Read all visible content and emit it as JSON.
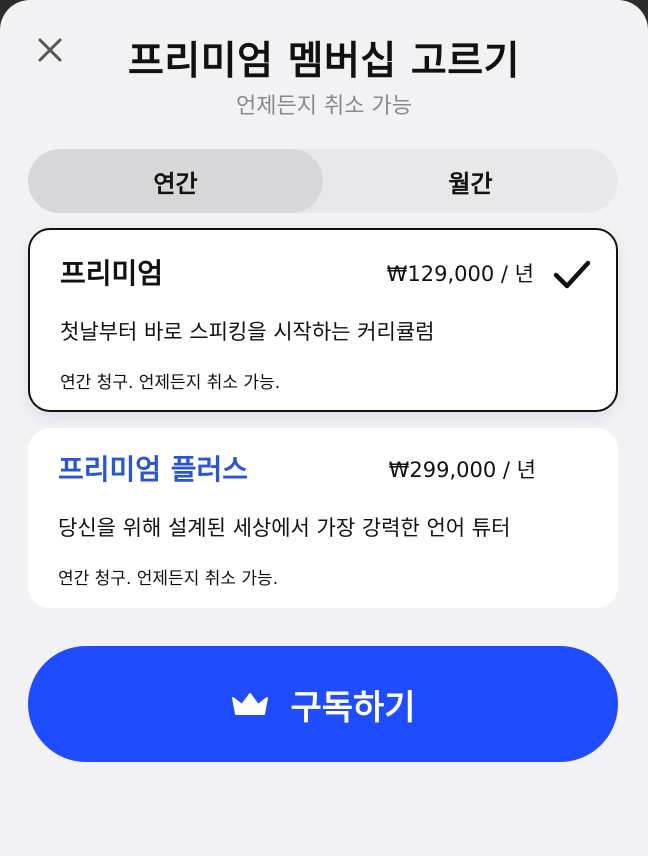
{
  "header": {
    "title": "프리미엄 멤버십 고르기",
    "subtitle": "언제든지 취소 가능"
  },
  "billing_toggle": {
    "options": [
      "연간",
      "월간"
    ],
    "selected": "연간"
  },
  "plans": [
    {
      "name": "프리미엄",
      "price": "₩129,000 / 년",
      "description": "첫날부터 바로 스피킹을 시작하는 커리큘럼",
      "billing": "연간 청구. 언제든지 취소 가능.",
      "selected": true,
      "name_color": "#111111"
    },
    {
      "name": "프리미엄 플러스",
      "price": "₩299,000 / 년",
      "description": "당신을 위해 설계된 세상에서 가장 강력한 언어 튜터",
      "billing": "연간 청구. 언제든지 취소 가능.",
      "selected": false,
      "name_color": "#2a56d6"
    }
  ],
  "cta": {
    "label": "구독하기",
    "icon": "crown-icon",
    "color": "#1f4cff"
  },
  "icons": {
    "close": "close-icon",
    "check": "check-icon"
  }
}
